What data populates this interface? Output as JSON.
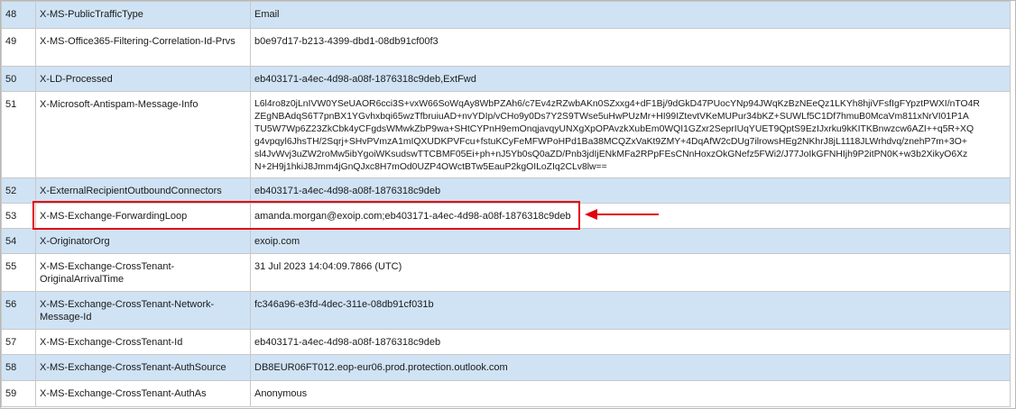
{
  "rows": [
    {
      "num": "48",
      "name": "X-MS-PublicTrafficType",
      "value": "Email",
      "h": 30
    },
    {
      "num": "49",
      "name": "X-MS-Office365-Filtering-Correlation-Id-Prvs",
      "value": "b0e97d17-b213-4399-dbd1-08db91cf00f3",
      "h": 42
    },
    {
      "num": "50",
      "name": "X-LD-Processed",
      "value": "eb403171-a4ec-4d98-a08f-1876318c9deb,ExtFwd",
      "h": 28
    },
    {
      "num": "51",
      "name": "X-Microsoft-Antispam-Message-Info",
      "value": "L6l4ro8z0jLnIVW0YSeUAOR6cci3S+vxW66SoWqAy8WbPZAh6/c7Ev4zRZwbAKn0SZxxg4+dF1Bj/9dGkD47PUocYNp94JWqKzBzNEeQz1LKYh8hjiVFsfIgFYpztPWXI/nTO4R\nZEgNBAdqS6T7pnBX1YGvhxbqi65wzTfbruiuAD+nvYDIp/vCHo9y0Ds7Y2S9TWse5uHwPUzMr+HI99IZtevtVKeMUPur34bKZ+SUWLf5C1Df7hmuB0McaVm811xNrVI01P1A\nTU5W7Wp6Z23ZkCbk4yCFgdsWMwkZbP9wa+SHtCYPnH9emOnqjavqyUNXgXpOPAvzkXubEm0WQI1GZxr2SeprIUqYUET9QptS9EzIJxrku9kKITKBnwzcw6AZI++q5R+XQ\ng4vpqyl6JhsTH/2Sqrj+SHvPVmzA1mIQXUDKPVFcu+fstuKCyFeMFWPoHPd1Ba38MCQZxVaKt9ZMY+4DqAfW2cDUg7ilrowsHEg2NKhrJ8jL1118JLWrhdvq/znehP7m+3O+\nsl4JvWvj3uZW2roMw5ibYgoiWKsudswTTCBMF05Ei+ph+nJ5Yb0sQ0aZD/Pnb3jdIjENkMFa2RPpFEsCNnHoxzOkGNefz5FWi2/J77JoIkGFNHIjh9P2itPN0K+w3b2XikyO6Xz\nN+2H9j1hkiJ8Jmm4jGnQJxc8H7mOd0UZP4OWctBTw5EauP2kgOILoZIq2CLv8lw==",
      "h": 96,
      "pre": true
    },
    {
      "num": "52",
      "name": "X-ExternalRecipientOutboundConnectors",
      "value": "eb403171-a4ec-4d98-a08f-1876318c9deb",
      "h": 28
    },
    {
      "num": "53",
      "name": "X-MS-Exchange-ForwardingLoop",
      "value": "amanda.morgan@exoip.com;eb403171-a4ec-4d98-a08f-1876318c9deb",
      "h": 28
    },
    {
      "num": "54",
      "name": "X-OriginatorOrg",
      "value": "exoip.com",
      "h": 28
    },
    {
      "num": "55",
      "name": "X-MS-Exchange-CrossTenant-OriginalArrivalTime",
      "value": "31 Jul 2023 14:04:09.7866 (UTC)",
      "h": 42
    },
    {
      "num": "56",
      "name": "X-MS-Exchange-CrossTenant-Network-Message-Id",
      "value": "fc346a96-e3fd-4dec-311e-08db91cf031b",
      "h": 42
    },
    {
      "num": "57",
      "name": "X-MS-Exchange-CrossTenant-Id",
      "value": "eb403171-a4ec-4d98-a08f-1876318c9deb",
      "h": 28
    },
    {
      "num": "58",
      "name": "X-MS-Exchange-CrossTenant-AuthSource",
      "value": "DB8EUR06FT012.eop-eur06.prod.protection.outlook.com",
      "h": 29
    },
    {
      "num": "59",
      "name": "X-MS-Exchange-CrossTenant-AuthAs",
      "value": "Anonymous",
      "h": 29
    }
  ],
  "colors": {
    "row_alt": "#cfe3f5",
    "highlight": "#e3000f"
  }
}
